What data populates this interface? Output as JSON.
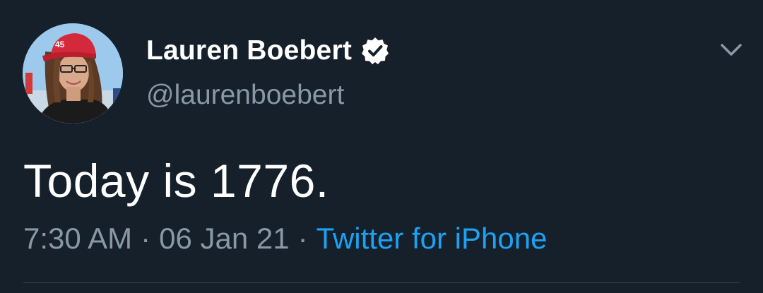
{
  "author": {
    "display_name": "Lauren Boebert",
    "handle": "@laurenboebert",
    "verified": true,
    "avatar_icon": "profile-photo",
    "avatar_hat_text": "45"
  },
  "tweet": {
    "text": "Today is 1776.",
    "time": "7:30 AM",
    "date": "06 Jan 21",
    "source": "Twitter for iPhone",
    "separator": "·"
  },
  "colors": {
    "background": "#15202b",
    "primary_text": "#ffffff",
    "secondary_text": "#8899a6",
    "link": "#1da1f2",
    "divider": "#38444d"
  },
  "icons": {
    "menu": "chevron-down-icon",
    "verified": "verified-badge-icon"
  }
}
